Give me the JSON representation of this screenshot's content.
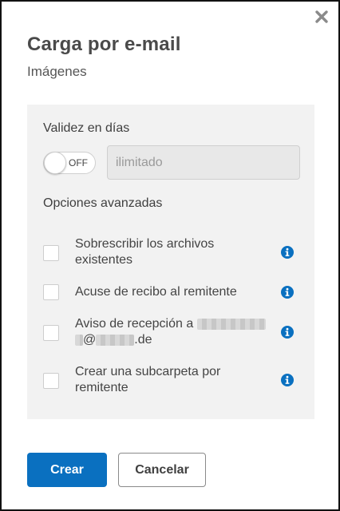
{
  "dialog": {
    "title": "Carga por e-mail",
    "subtitle": "Imágenes",
    "close_icon": "close-icon"
  },
  "validity": {
    "label": "Validez en días",
    "toggle_state": "OFF",
    "days_placeholder": "ilimitado"
  },
  "advanced": {
    "label": "Opciones avanzadas",
    "options": [
      {
        "label": "Sobrescribir los archivos existentes",
        "checked": false
      },
      {
        "label": "Acuse de recibo al remitente",
        "checked": false
      },
      {
        "label_prefix": "Aviso de recepción a",
        "label_at": "@",
        "label_suffix": ".de",
        "checked": false
      },
      {
        "label": "Crear una subcarpeta por remitente",
        "checked": false
      }
    ]
  },
  "actions": {
    "create_label": "Crear",
    "cancel_label": "Cancelar"
  },
  "colors": {
    "primary": "#0a70c0",
    "info": "#0a70c0",
    "panel_bg": "#f2f2f2"
  }
}
